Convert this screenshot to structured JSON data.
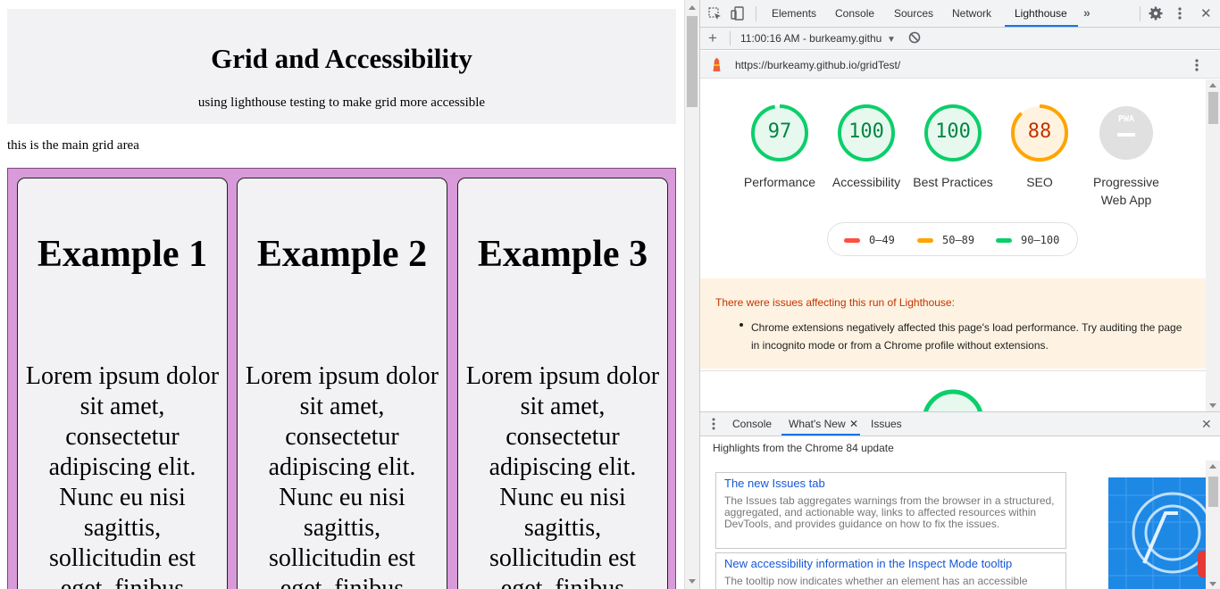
{
  "page": {
    "title": "Grid and Accessibility",
    "subtitle": "using lighthouse testing to make grid more accessible",
    "note": "this is the main grid area",
    "cards": [
      {
        "heading": "Example 1",
        "text": "Lorem ipsum dolor sit amet, consectetur adipiscing elit. Nunc eu nisi sagittis, sollicitudin est eget, finibus"
      },
      {
        "heading": "Example 2",
        "text": "Lorem ipsum dolor sit amet, consectetur adipiscing elit. Nunc eu nisi sagittis, sollicitudin est eget, finibus"
      },
      {
        "heading": "Example 3",
        "text": "Lorem ipsum dolor sit amet, consectetur adipiscing elit. Nunc eu nisi sagittis, sollicitudin est eget, finibus"
      }
    ],
    "colors": {
      "grid_bg": "#d89ad8",
      "card_bg": "#f2f2f5"
    }
  },
  "devtools": {
    "tabs": [
      "Elements",
      "Console",
      "Sources",
      "Network",
      "Lighthouse"
    ],
    "active_tab": "Lighthouse",
    "toolbar": {
      "report_selector": "11:00:16 AM - burkeamy.githu"
    },
    "url": "https://burkeamy.github.io/gridTest/",
    "scores": [
      {
        "value": 97,
        "label": "Performance",
        "color": "#0cce6b"
      },
      {
        "value": 100,
        "label": "Accessibility",
        "color": "#0cce6b"
      },
      {
        "value": 100,
        "label": "Best Practices",
        "color": "#0cce6b"
      },
      {
        "value": 88,
        "label": "SEO",
        "color": "#ffa400"
      },
      {
        "value": null,
        "label": "Progressive Web App",
        "badge": "PWA",
        "color": "#cccccc"
      }
    ],
    "legend": [
      {
        "range": "0–49",
        "color": "#ff4e42"
      },
      {
        "range": "50–89",
        "color": "#ffa400"
      },
      {
        "range": "90–100",
        "color": "#0cce6b"
      }
    ],
    "warning": {
      "title": "There were issues affecting this run of Lighthouse:",
      "items": [
        "Chrome extensions negatively affected this page's load performance. Try auditing the page in incognito mode or from a Chrome profile without extensions."
      ]
    },
    "drawer": {
      "tabs": [
        "Console",
        "What's New",
        "Issues"
      ],
      "active_tab": "What's New",
      "heading": "Highlights from the Chrome 84 update",
      "news": [
        {
          "title": "The new Issues tab",
          "description": "The Issues tab aggregates warnings from the browser in a structured, aggregated, and actionable way, links to affected resources within DevTools, and provides guidance on how to fix the issues."
        },
        {
          "title": "New accessibility information in the Inspect Mode tooltip",
          "description": "The tooltip now indicates whether an element has an accessible"
        }
      ]
    }
  }
}
